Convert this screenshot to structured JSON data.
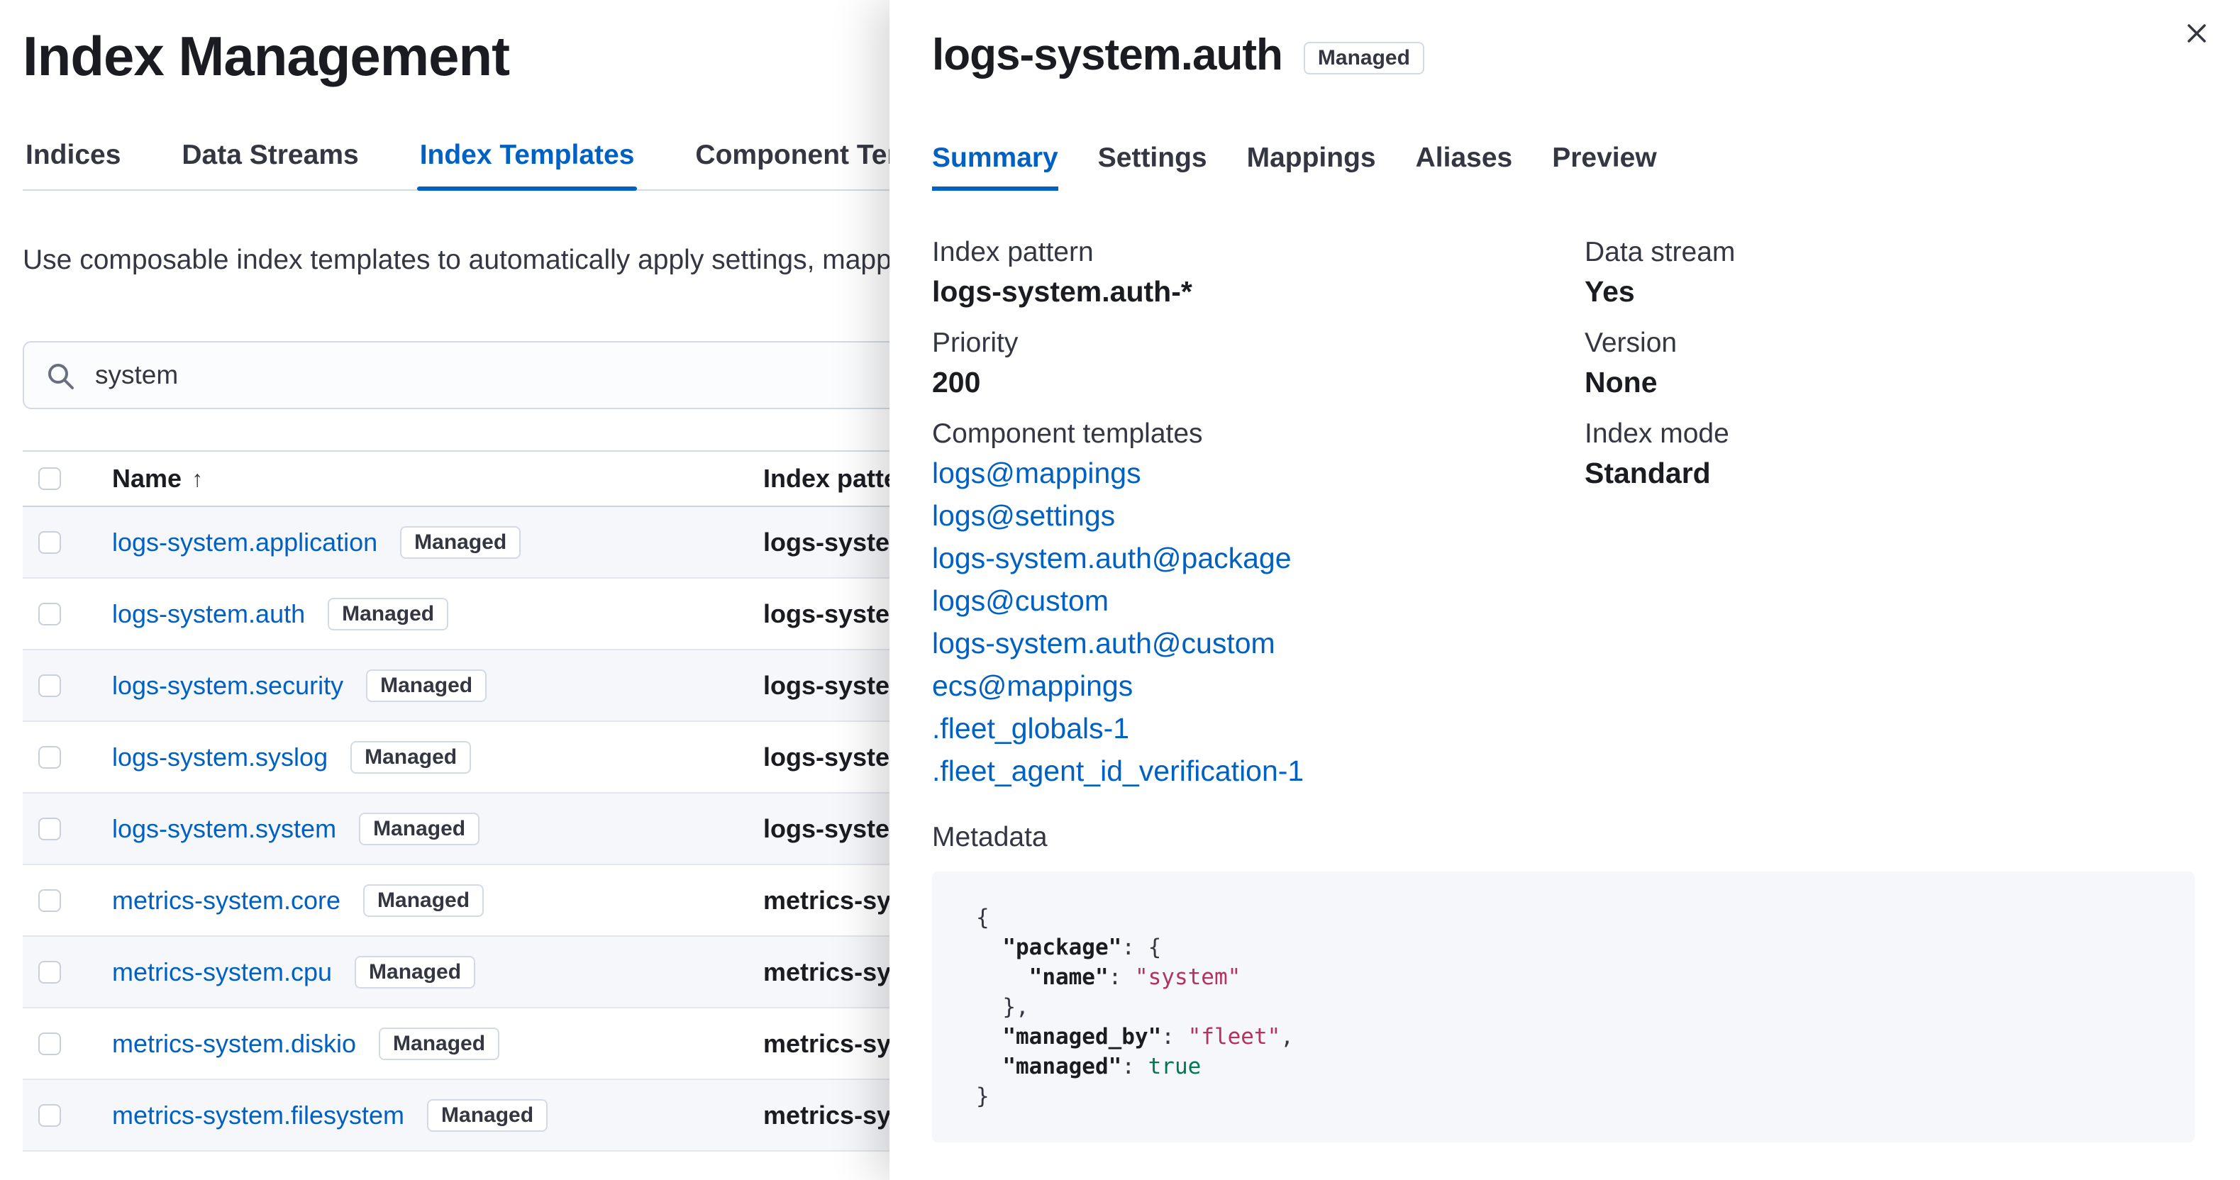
{
  "colors": {
    "link": "#0061c2",
    "codeString": "#b4325d",
    "codeBoolean": "#007857"
  },
  "page": {
    "title": "Index Management",
    "tabs": [
      {
        "label": "Indices",
        "active": false
      },
      {
        "label": "Data Streams",
        "active": false
      },
      {
        "label": "Index Templates",
        "active": true
      },
      {
        "label": "Component Templates",
        "active": false
      }
    ],
    "description": "Use composable index templates to automatically apply settings, mappings, and aliases to your indices.",
    "search": {
      "value": "system"
    },
    "table": {
      "columns": [
        {
          "label": "Name",
          "sort": "ascending"
        },
        {
          "label": "Index patterns"
        }
      ],
      "rows": [
        {
          "name": "logs-system.application",
          "badge": "Managed",
          "pattern": "logs-system.application-*"
        },
        {
          "name": "logs-system.auth",
          "badge": "Managed",
          "pattern": "logs-system.auth-*"
        },
        {
          "name": "logs-system.security",
          "badge": "Managed",
          "pattern": "logs-system.security-*"
        },
        {
          "name": "logs-system.syslog",
          "badge": "Managed",
          "pattern": "logs-system.syslog-*"
        },
        {
          "name": "logs-system.system",
          "badge": "Managed",
          "pattern": "logs-system.system-*"
        },
        {
          "name": "metrics-system.core",
          "badge": "Managed",
          "pattern": "metrics-system.core-*"
        },
        {
          "name": "metrics-system.cpu",
          "badge": "Managed",
          "pattern": "metrics-system.cpu-*"
        },
        {
          "name": "metrics-system.diskio",
          "badge": "Managed",
          "pattern": "metrics-system.diskio-*"
        },
        {
          "name": "metrics-system.filesystem",
          "badge": "Managed",
          "pattern": "metrics-system.filesystem-*"
        }
      ]
    }
  },
  "flyout": {
    "title": "logs-system.auth",
    "badge": "Managed",
    "tabs": [
      {
        "label": "Summary",
        "active": true
      },
      {
        "label": "Settings",
        "active": false
      },
      {
        "label": "Mappings",
        "active": false
      },
      {
        "label": "Aliases",
        "active": false
      },
      {
        "label": "Preview",
        "active": false
      }
    ],
    "summary_left": [
      {
        "label": "Index pattern",
        "value": "logs-system.auth-*"
      },
      {
        "label": "Priority",
        "value": "200"
      }
    ],
    "component_templates": {
      "label": "Component templates",
      "items": [
        "logs@mappings",
        "logs@settings",
        "logs-system.auth@package",
        "logs@custom",
        "logs-system.auth@custom",
        "ecs@mappings",
        ".fleet_globals-1",
        ".fleet_agent_id_verification-1"
      ]
    },
    "summary_right": [
      {
        "label": "Data stream",
        "value": "Yes"
      },
      {
        "label": "Version",
        "value": "None"
      },
      {
        "label": "Index mode",
        "value": "Standard"
      }
    ],
    "metadata": {
      "label": "Metadata",
      "code": [
        [
          {
            "t": "{",
            "c": "plain"
          }
        ],
        [
          {
            "t": "  ",
            "c": "plain"
          },
          {
            "t": "\"package\"",
            "c": "key"
          },
          {
            "t": ": {",
            "c": "plain"
          }
        ],
        [
          {
            "t": "    ",
            "c": "plain"
          },
          {
            "t": "\"name\"",
            "c": "key"
          },
          {
            "t": ": ",
            "c": "plain"
          },
          {
            "t": "\"system\"",
            "c": "str"
          }
        ],
        [
          {
            "t": "  },",
            "c": "plain"
          }
        ],
        [
          {
            "t": "  ",
            "c": "plain"
          },
          {
            "t": "\"managed_by\"",
            "c": "key"
          },
          {
            "t": ": ",
            "c": "plain"
          },
          {
            "t": "\"fleet\"",
            "c": "str"
          },
          {
            "t": ",",
            "c": "plain"
          }
        ],
        [
          {
            "t": "  ",
            "c": "plain"
          },
          {
            "t": "\"managed\"",
            "c": "key"
          },
          {
            "t": ": ",
            "c": "plain"
          },
          {
            "t": "true",
            "c": "bool"
          }
        ],
        [
          {
            "t": "}",
            "c": "plain"
          }
        ]
      ]
    }
  }
}
